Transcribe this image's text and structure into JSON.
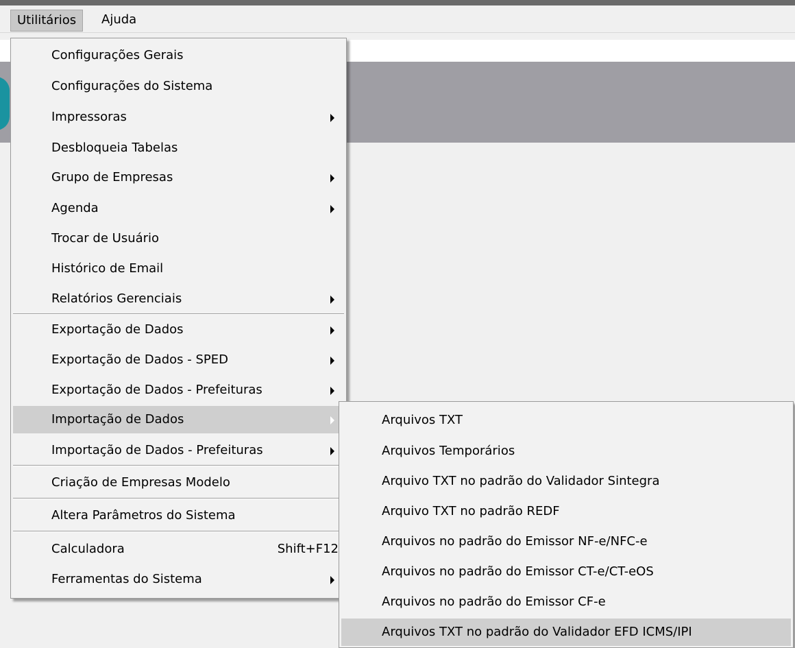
{
  "menubar": {
    "items": [
      {
        "label": "Utilitários"
      },
      {
        "label": "Ajuda"
      }
    ]
  },
  "utilities_menu": {
    "items": [
      {
        "label": "Configurações Gerais"
      },
      {
        "label": "Configurações do Sistema"
      },
      {
        "label": "Impressoras"
      },
      {
        "label": "Desbloqueia Tabelas"
      },
      {
        "label": "Grupo de Empresas"
      },
      {
        "label": "Agenda"
      },
      {
        "label": "Trocar de Usuário"
      },
      {
        "label": "Histórico de Email"
      },
      {
        "label": "Relatórios Gerenciais"
      },
      {
        "label": "Exportação de Dados"
      },
      {
        "label": "Exportação de Dados - SPED"
      },
      {
        "label": "Exportação de Dados - Prefeituras"
      },
      {
        "label": "Importação de Dados"
      },
      {
        "label": "Importação de Dados - Prefeituras"
      },
      {
        "label": "Criação de Empresas Modelo"
      },
      {
        "label": "Altera Parâmetros do Sistema"
      },
      {
        "label": "Calculadora",
        "shortcut": "Shift+F12"
      },
      {
        "label": "Ferramentas do Sistema"
      }
    ]
  },
  "import_submenu": {
    "items": [
      {
        "label": "Arquivos TXT"
      },
      {
        "label": "Arquivos Temporários"
      },
      {
        "label": "Arquivo TXT no padrão do Validador Sintegra"
      },
      {
        "label": "Arquivo TXT no padrão REDF"
      },
      {
        "label": "Arquivos no padrão do Emissor NF-e/NFC-e"
      },
      {
        "label": "Arquivos no padrão do Emissor CT-e/CT-eOS"
      },
      {
        "label": "Arquivos no padrão do Emissor CF-e"
      },
      {
        "label": "Arquivos TXT no padrão do Validador EFD ICMS/IPI"
      }
    ]
  }
}
